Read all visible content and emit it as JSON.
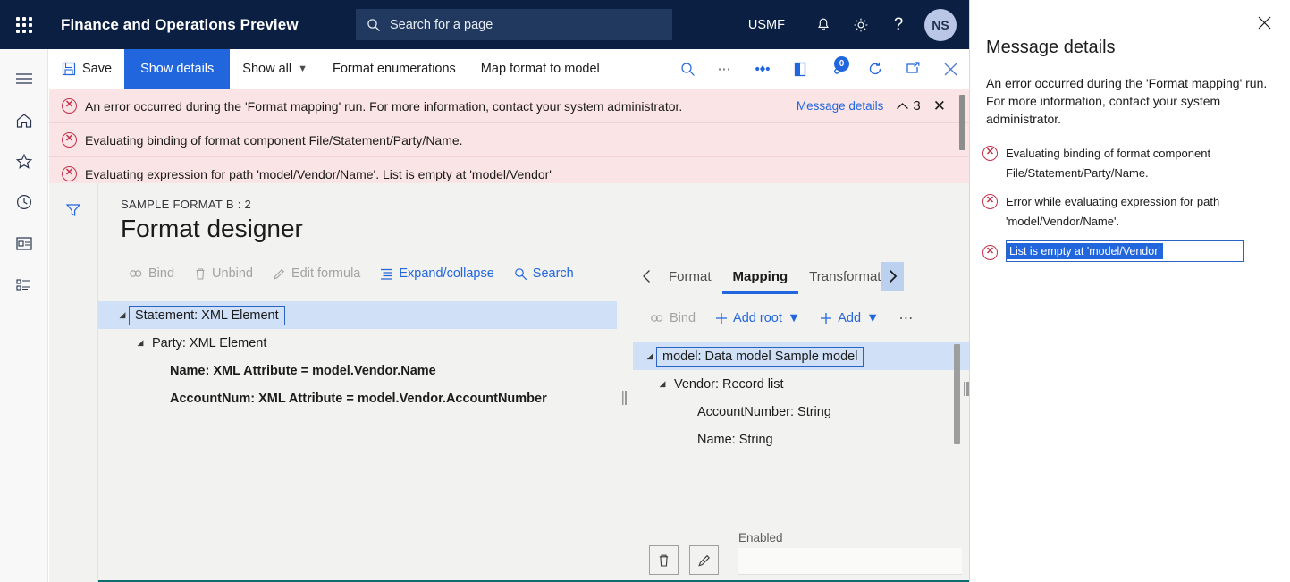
{
  "topbar": {
    "waffle_label": "App launcher",
    "app_title": "Finance and Operations Preview",
    "search_placeholder": "Search for a page",
    "company": "USMF",
    "notifications_icon": "bell-icon",
    "settings_icon": "gear-icon",
    "help_icon": "question-icon",
    "avatar_initials": "NS"
  },
  "rail": {
    "items": [
      {
        "name": "hamburger-icon",
        "label": "Expand navigation"
      },
      {
        "name": "home-icon",
        "label": "Home"
      },
      {
        "name": "star-icon",
        "label": "Favorites"
      },
      {
        "name": "clock-icon",
        "label": "Recent"
      },
      {
        "name": "workspace-icon",
        "label": "Workspaces"
      },
      {
        "name": "modules-icon",
        "label": "Modules"
      }
    ]
  },
  "commandbar": {
    "save": "Save",
    "show_details": "Show details",
    "show_all": "Show all",
    "format_enumerations": "Format enumerations",
    "map_format_to_model": "Map format to model",
    "search_icon": "search-icon",
    "overflow_icon": "ellipsis-icon",
    "share_icon": "share-icon",
    "office_icon": "office-icon",
    "attachments_icon": "attachment-icon",
    "attachments_count": "0",
    "refresh_icon": "refresh-icon",
    "popout_icon": "open-in-new-window-icon",
    "close_icon": "close-icon"
  },
  "messagebar": {
    "messages": [
      "An error occurred during the 'Format mapping' run. For more information, contact your system administrator.",
      "Evaluating binding of format component File/Statement/Party/Name.",
      "Evaluating expression for path 'model/Vendor/Name'.   List is empty at 'model/Vendor'"
    ],
    "details_link": "Message details",
    "count": "3",
    "collapse_icon": "chevron-up-icon",
    "close_icon": "close-icon"
  },
  "page": {
    "breadcrumb": "SAMPLE FORMAT B : 2",
    "title": "Format designer",
    "filter_icon": "filter-icon"
  },
  "format_pane": {
    "toolbar": [
      {
        "label": "Bind",
        "icon": "bind-icon",
        "state": "disabled"
      },
      {
        "label": "Unbind",
        "icon": "trash-icon",
        "state": "disabled"
      },
      {
        "label": "Edit formula",
        "icon": "pencil-icon",
        "state": "disabled"
      },
      {
        "label": "Expand/collapse",
        "icon": "list-icon",
        "state": "active"
      },
      {
        "label": "Search",
        "icon": "search-icon",
        "state": "active"
      }
    ],
    "tree": [
      {
        "label": "Statement: XML Element",
        "indent": 0,
        "expander": "◢",
        "selected": true
      },
      {
        "label": "Party: XML Element",
        "indent": 1,
        "expander": "◢",
        "selected": false
      },
      {
        "label": "Name: XML Attribute = model.Vendor.Name",
        "indent": 2,
        "expander": "",
        "selected": false
      },
      {
        "label": "AccountNum: XML Attribute = model.Vendor.AccountNumber",
        "indent": 2,
        "expander": "",
        "selected": false
      }
    ]
  },
  "mapping_pane": {
    "tabs": [
      {
        "label": "Format",
        "selected": false
      },
      {
        "label": "Mapping",
        "selected": true
      },
      {
        "label": "Transformations",
        "selected": false
      }
    ],
    "prev_icon": "chevron-left-icon",
    "next_icon": "chevron-right-icon",
    "toolbar": [
      {
        "label": "Bind",
        "icon": "bind-icon",
        "state": "disabled"
      },
      {
        "label": "Add root",
        "icon": "plus-icon",
        "state": "active",
        "caret": true
      },
      {
        "label": "Add",
        "icon": "plus-icon",
        "state": "active",
        "caret": true
      },
      {
        "label": "",
        "icon": "ellipsis-icon",
        "state": "active"
      }
    ],
    "tree": [
      {
        "label": "model: Data model Sample model",
        "indent": 0,
        "expander": "◢",
        "selected": true
      },
      {
        "label": "Vendor: Record list",
        "indent": 1,
        "expander": "◢",
        "selected": false
      },
      {
        "label": "AccountNumber: String",
        "indent": 2,
        "expander": "",
        "selected": false
      },
      {
        "label": "Name: String",
        "indent": 2,
        "expander": "",
        "selected": false
      }
    ],
    "delete_icon": "trash-icon",
    "edit_icon": "pencil-icon",
    "enabled_label": "Enabled",
    "enabled_value": ""
  },
  "flyout": {
    "close_icon": "close-icon",
    "title": "Message details",
    "summary": "An error occurred during the 'Format mapping' run. For more information, contact your system administrator.",
    "items": [
      {
        "text": "Evaluating binding of format component File/Statement/Party/Name.",
        "highlighted": false
      },
      {
        "text": "Error while evaluating expression for path 'model/Vendor/Name'.",
        "highlighted": false
      },
      {
        "text": "List is empty at 'model/Vendor'",
        "highlighted": true
      }
    ]
  },
  "colors": {
    "nav_background": "#0b1f42",
    "accent": "#2266dd",
    "error_background": "#fbe4e6",
    "error_icon": "#c4314b",
    "selection": "#cfe0f7",
    "content_background": "#f2f2f0"
  }
}
